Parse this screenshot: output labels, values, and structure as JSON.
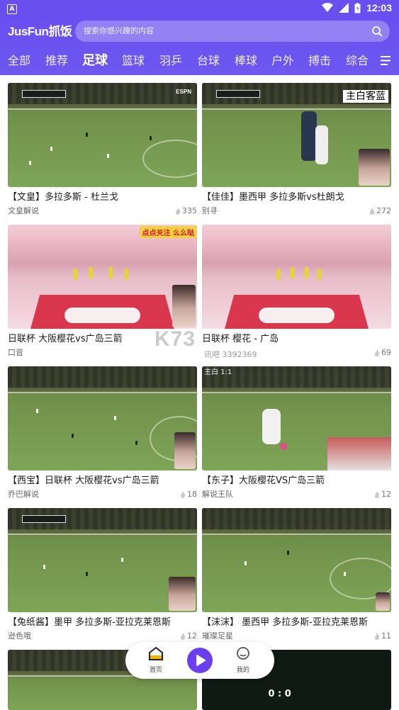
{
  "status_bar": {
    "time": "12:03",
    "app_icon_letter": "A"
  },
  "header": {
    "logo": "JusFun抓饭",
    "search_placeholder": "搜索你感兴趣的内容"
  },
  "tabs": [
    "全部",
    "推荐",
    "足球",
    "篮球",
    "羽乒",
    "台球",
    "棒球",
    "户外",
    "搏击",
    "综合"
  ],
  "active_tab": "足球",
  "videos": [
    {
      "title": "【文皇】多拉多斯 - 杜兰戈",
      "author": "文皇解说",
      "likes": "335",
      "overlay": ""
    },
    {
      "title": "【佳佳】墨西甲 多拉多斯vs杜朗戈",
      "author": "别寻",
      "likes": "272",
      "overlay": "主白客蓝"
    },
    {
      "title": "日联杯 大阪樱花vs广岛三箭",
      "author": "口音",
      "likes": "",
      "overlay": "点点关注 么么哒"
    },
    {
      "title": "日联杯 樱花 - 广岛",
      "author": "",
      "likes": "69",
      "overlay": ""
    },
    {
      "title": "【西宝】日联杯 大阪樱花vs广岛三箭",
      "author": "乔巴解说",
      "likes": "18",
      "overlay": ""
    },
    {
      "title": "【东子】大阪樱花VS广岛三箭",
      "author": "解说王队",
      "likes": "12",
      "overlay": ""
    },
    {
      "title": "【兔纸酱】墨甲 多拉多斯-亚拉克莱恩斯",
      "author": "逊色哦",
      "likes": "12",
      "overlay": ""
    },
    {
      "title": "【沫沫】 墨西甲 多拉多斯-亚拉克莱恩斯",
      "author": "璀璨足星",
      "likes": "11",
      "overlay": ""
    }
  ],
  "watermark": {
    "text": "K73",
    "count_text": "讯吧 3392369",
    "sub_text": "主白 1:1"
  },
  "bottom_cards": {
    "right_score": "0 : 0"
  },
  "bottom_nav": {
    "home_label": "首页",
    "mine_label": "我的"
  },
  "colors": {
    "brand": "#6a4ff0",
    "play_button": "#6b3ff0"
  }
}
